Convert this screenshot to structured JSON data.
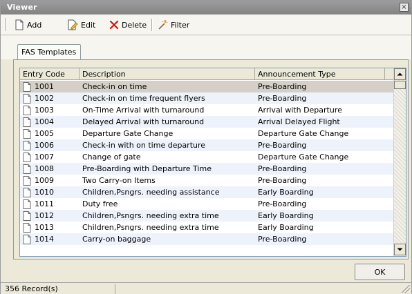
{
  "window": {
    "title": "Viewer",
    "close_glyph": "×"
  },
  "toolbar": {
    "add_label": "Add",
    "edit_label": "Edit",
    "delete_label": "Delete",
    "filter_label": "Filter"
  },
  "tabs": [
    {
      "label": "FAS Templates"
    }
  ],
  "table": {
    "columns": [
      "Entry Code",
      "Description",
      "Announcement Type"
    ],
    "rows": [
      {
        "code": "1001",
        "description": "Check-in on time",
        "type": "Pre-Boarding"
      },
      {
        "code": "1002",
        "description": "Check-in on time frequent flyers",
        "type": "Pre-Boarding"
      },
      {
        "code": "1003",
        "description": "On-Time Arrival with turnaround",
        "type": "Arrival with Departure"
      },
      {
        "code": "1004",
        "description": "Delayed Arrival with turnaround",
        "type": "Arrival Delayed Flight"
      },
      {
        "code": "1005",
        "description": "Departure Gate Change",
        "type": "Departure Gate Change"
      },
      {
        "code": "1006",
        "description": "Check-in with on time departure",
        "type": "Pre-Boarding"
      },
      {
        "code": "1007",
        "description": "Change of gate",
        "type": "Departure Gate Change"
      },
      {
        "code": "1008",
        "description": "Pre-Boarding with Departure Time",
        "type": "Pre-Boarding"
      },
      {
        "code": "1009",
        "description": "Two Carry-on Items",
        "type": "Pre-Boarding"
      },
      {
        "code": "1010",
        "description": "Children,Psngrs. needing assistance",
        "type": "Early Boarding"
      },
      {
        "code": "1011",
        "description": "Duty free",
        "type": "Pre-Boarding"
      },
      {
        "code": "1012",
        "description": "Children,Psngrs. needing extra time",
        "type": "Early Boarding"
      },
      {
        "code": "1013",
        "description": "Children,Psngrs. needing extra time",
        "type": "Early Boarding"
      },
      {
        "code": "1014",
        "description": "Carry-on baggage",
        "type": "Pre-Boarding"
      }
    ],
    "selected_row": 0
  },
  "footer": {
    "ok_label": "OK"
  },
  "statusbar": {
    "record_count": "356 Record(s)"
  },
  "colors": {
    "selected_row": "#d4d0c8",
    "alt_row": "#eef2fa",
    "titlebar": "#8f8f8f"
  }
}
